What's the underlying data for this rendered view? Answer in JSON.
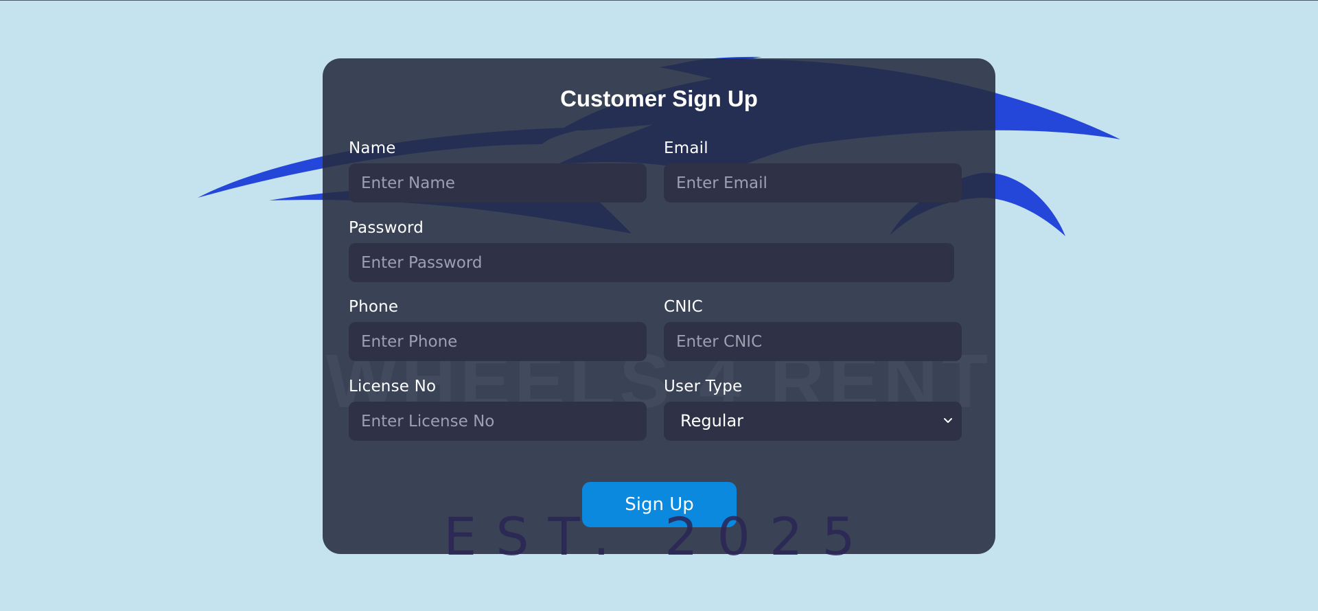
{
  "form": {
    "title": "Customer Sign Up",
    "fields": {
      "name": {
        "label": "Name",
        "placeholder": "Enter Name"
      },
      "email": {
        "label": "Email",
        "placeholder": "Enter Email"
      },
      "password": {
        "label": "Password",
        "placeholder": "Enter Password"
      },
      "phone": {
        "label": "Phone",
        "placeholder": "Enter Phone"
      },
      "cnic": {
        "label": "CNIC",
        "placeholder": "Enter CNIC"
      },
      "license": {
        "label": "License No",
        "placeholder": "Enter License No"
      },
      "user_type": {
        "label": "User Type",
        "selected": "Regular"
      }
    },
    "submit_label": "Sign Up"
  },
  "background": {
    "watermark": "WHEELS 4 RENT",
    "established": "EST. 2025",
    "logo_icon": "car-silhouette-logo"
  },
  "colors": {
    "page_bg": "#c5e3ee",
    "card_bg": "#262c40",
    "input_bg": "#2f3246",
    "button": "#0a89df",
    "logo_blue": "#2547d9"
  }
}
